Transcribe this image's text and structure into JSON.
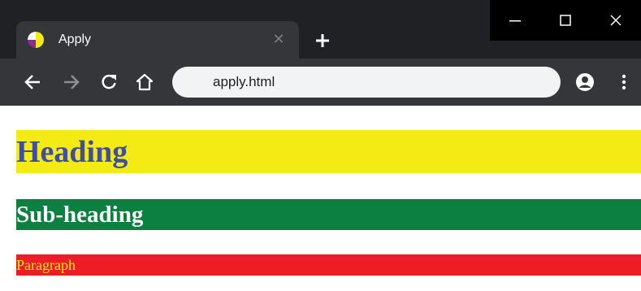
{
  "tab": {
    "title": "Apply",
    "close_glyph": "✕",
    "favicon": "circle-quadrant-favicon-icon"
  },
  "window_controls": {
    "minimize": "minimize-icon",
    "maximize": "maximize-icon",
    "close": "close-icon"
  },
  "toolbar": {
    "back": "arrow-left-icon",
    "forward": "arrow-right-icon",
    "reload": "reload-icon",
    "home": "home-icon",
    "address": "apply.html",
    "profile": "account-circle-icon",
    "menu": "kebab-menu-icon"
  },
  "page": {
    "heading": "Heading",
    "subheading": "Sub-heading",
    "paragraph": "Paragraph"
  },
  "colors": {
    "titlebar_bg": "#202124",
    "tab_bg": "#35363a",
    "omnibox_bg": "#f1f3f4",
    "heading_bg": "#f5eb14",
    "heading_text": "#3f4ea0",
    "subheading_bg": "#0b8040",
    "subheading_text": "#ffffff",
    "paragraph_bg": "#ee1c25",
    "paragraph_text": "#f5eb14"
  }
}
